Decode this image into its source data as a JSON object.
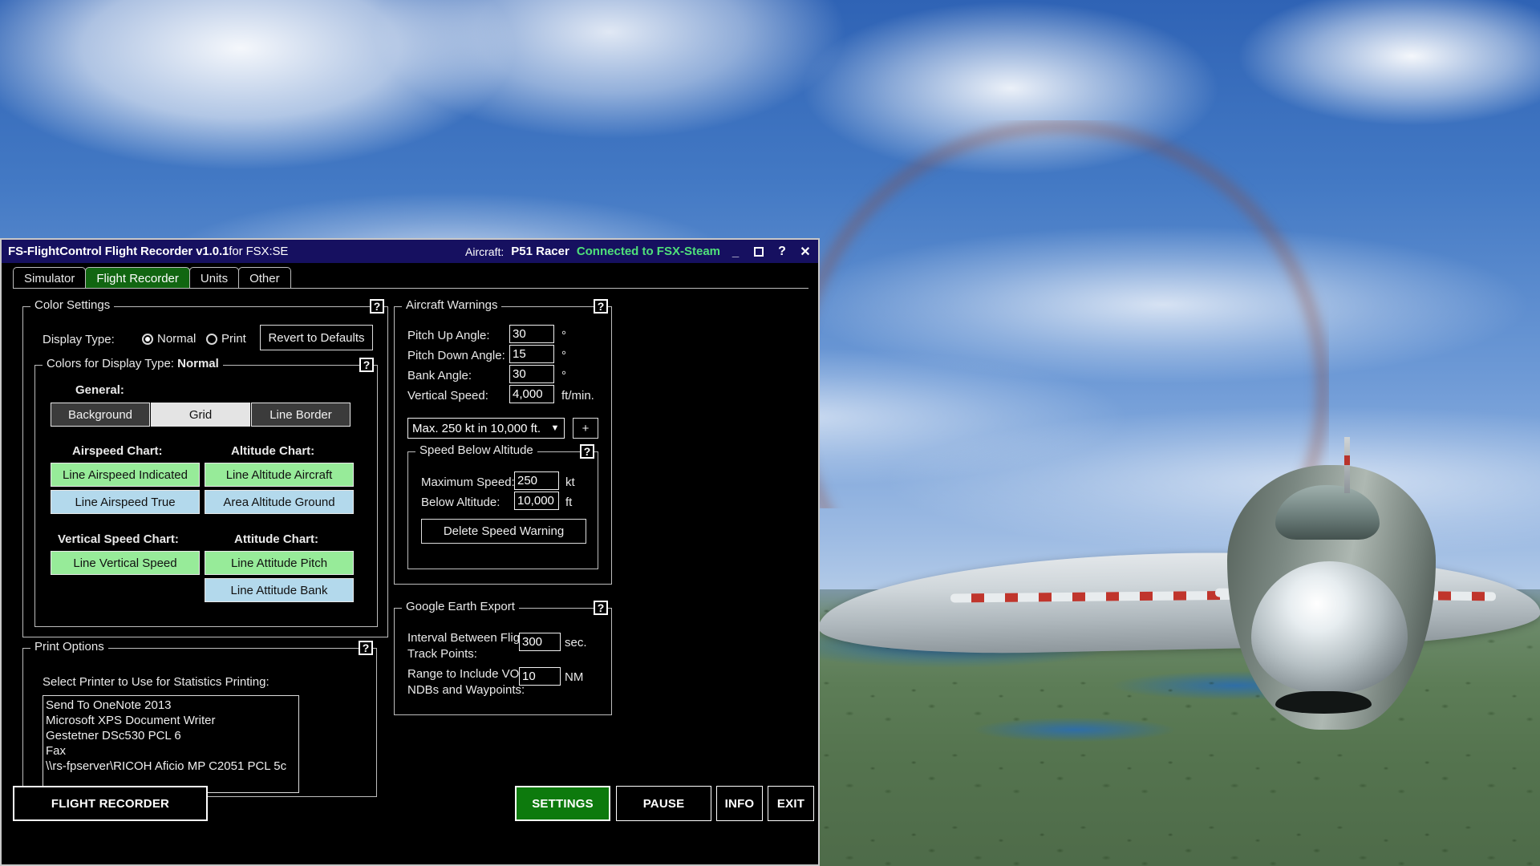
{
  "window": {
    "title_main": "FS-FlightControl Flight Recorder ",
    "title_version": "v1.0.1",
    "title_suffix": "for FSX:SE",
    "aircraft_label": "Aircraft:",
    "aircraft_value": "P51 Racer",
    "connection_status": "Connected to FSX-Steam",
    "minimize_icon": "minimize-icon",
    "maximize_icon": "maximize-icon",
    "help_icon": "help-icon",
    "close_icon": "close-icon",
    "titlebar_color": "#161060",
    "accent_green": "#116611"
  },
  "tabs": [
    {
      "label": "Simulator",
      "active": false
    },
    {
      "label": "Flight Recorder",
      "active": true
    },
    {
      "label": "Units",
      "active": false
    },
    {
      "label": "Other",
      "active": false
    }
  ],
  "color_settings": {
    "legend": "Color Settings",
    "help": "?",
    "display_type_label": "Display Type:",
    "options": [
      {
        "label": "Normal",
        "selected": true
      },
      {
        "label": "Print",
        "selected": false
      }
    ],
    "revert_button": "Revert to Defaults",
    "inner": {
      "legend_prefix": "Colors for Display Type: ",
      "legend_value": "Normal",
      "help": "?",
      "general_label": "General:",
      "general_buttons": [
        {
          "label": "Background",
          "style": "dark",
          "color": "#3b3b3b"
        },
        {
          "label": "Grid",
          "style": "light",
          "color": "#e4e4e4"
        },
        {
          "label": "Line Border",
          "style": "dark",
          "color": "#3b3b3b"
        }
      ],
      "groups": [
        {
          "title": "Airspeed Chart:",
          "buttons": [
            {
              "label": "Line Airspeed Indicated",
              "style": "green",
              "color": "#97eb99"
            },
            {
              "label": "Line Airspeed True",
              "style": "blue",
              "color": "#b3d9ec"
            }
          ]
        },
        {
          "title": "Altitude Chart:",
          "buttons": [
            {
              "label": "Line Altitude Aircraft",
              "style": "green",
              "color": "#97eb99"
            },
            {
              "label": "Area Altitude Ground",
              "style": "blue",
              "color": "#b3d9ec"
            }
          ]
        },
        {
          "title": "Vertical Speed Chart:",
          "buttons": [
            {
              "label": "Line Vertical Speed",
              "style": "green",
              "color": "#97eb99"
            }
          ]
        },
        {
          "title": "Attitude Chart:",
          "buttons": [
            {
              "label": "Line Attitude Pitch",
              "style": "green",
              "color": "#97eb99"
            },
            {
              "label": "Line Attitude Bank",
              "style": "blue",
              "color": "#b3d9ec"
            }
          ]
        }
      ]
    }
  },
  "print_options": {
    "legend": "Print Options",
    "help": "?",
    "select_label": "Select Printer to Use for Statistics Printing:",
    "printers": [
      "Send To OneNote 2013",
      "Microsoft XPS Document Writer",
      "Gestetner DSc530 PCL 6",
      "Fax",
      "\\\\rs-fpserver\\RICOH Aficio MP C2051 PCL 5c"
    ]
  },
  "aircraft_warnings": {
    "legend": "Aircraft Warnings",
    "help": "?",
    "fields": [
      {
        "label": "Pitch Up Angle:",
        "value": "30",
        "unit": "°"
      },
      {
        "label": "Pitch Down Angle:",
        "value": "15",
        "unit": "°"
      },
      {
        "label": "Bank Angle:",
        "value": "30",
        "unit": "°"
      },
      {
        "label": "Vertical Speed:",
        "value": "4,000",
        "unit": "ft/min."
      }
    ],
    "warning_select_value": "Max. 250 kt in 10,000 ft.",
    "dropdown_icon": "chevron-down-icon",
    "add_button": "+",
    "speed_below_altitude": {
      "legend": "Speed Below Altitude",
      "help": "?",
      "fields": [
        {
          "label": "Maximum Speed:",
          "value": "250",
          "unit": "kt"
        },
        {
          "label": "Below Altitude:",
          "value": "10,000",
          "unit": "ft"
        }
      ],
      "delete_button": "Delete Speed Warning"
    }
  },
  "google_earth_export": {
    "legend": "Google Earth Export",
    "help": "?",
    "fields": [
      {
        "label_line1": "Interval Between Flight",
        "label_line2": "Track Points:",
        "value": "300",
        "unit": "sec."
      },
      {
        "label_line1": "Range to Include VORs,",
        "label_line2": "NDBs and Waypoints:",
        "value": "10",
        "unit": "NM"
      }
    ]
  },
  "footer": {
    "flight_recorder_button": "FLIGHT RECORDER",
    "settings_button": "SETTINGS",
    "pause_button": "PAUSE",
    "info_button": "INFO",
    "exit_button": "EXIT",
    "settings_active_color": "#0d7a0d"
  }
}
